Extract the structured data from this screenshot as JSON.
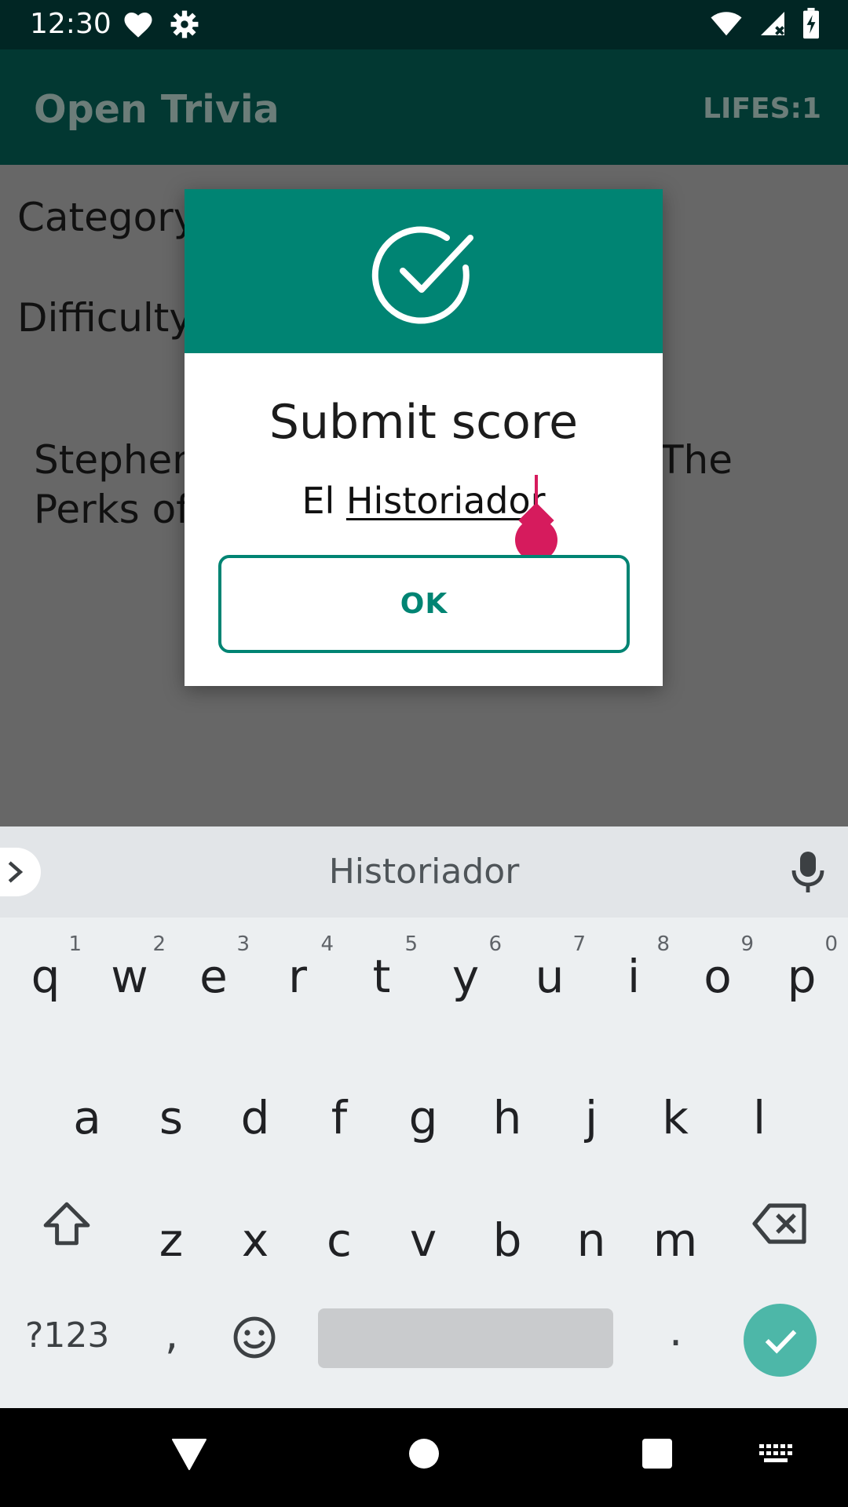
{
  "status_bar": {
    "time": "12:30"
  },
  "app_bar": {
    "title": "Open Trivia",
    "lifes": "LIFES:1"
  },
  "content": {
    "category_label": "Category",
    "difficulty_label": "Difficulty:",
    "question_line1": "Stephen",
    "question_line1_end": "The",
    "question_line2": "Perks of"
  },
  "dialog": {
    "title": "Submit score",
    "name_prefix": "El ",
    "name_word": "Historiador",
    "ok_label": "OK"
  },
  "keyboard": {
    "suggestion": "Historiador",
    "row1": [
      {
        "k": "q",
        "h": "1"
      },
      {
        "k": "w",
        "h": "2"
      },
      {
        "k": "e",
        "h": "3"
      },
      {
        "k": "r",
        "h": "4"
      },
      {
        "k": "t",
        "h": "5"
      },
      {
        "k": "y",
        "h": "6"
      },
      {
        "k": "u",
        "h": "7"
      },
      {
        "k": "i",
        "h": "8"
      },
      {
        "k": "o",
        "h": "9"
      },
      {
        "k": "p",
        "h": "0"
      }
    ],
    "row2": [
      "a",
      "s",
      "d",
      "f",
      "g",
      "h",
      "j",
      "k",
      "l"
    ],
    "row3": [
      "z",
      "x",
      "c",
      "v",
      "b",
      "n",
      "m"
    ],
    "symbols_label": "?123",
    "comma": ",",
    "period": "."
  },
  "colors": {
    "accent": "#008473",
    "cursor": "#d61b5d",
    "enter": "#4db7a8"
  }
}
